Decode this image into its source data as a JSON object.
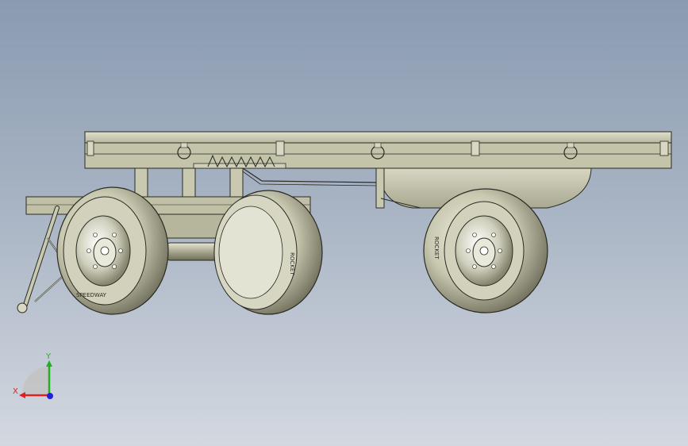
{
  "viewport": {
    "background_top": "#8a9bb1",
    "background_bottom": "#d3d8e0"
  },
  "model": {
    "body_color": "#c9c9b1",
    "shade_color": "#8f8f7a",
    "line_color": "#2a2a22",
    "tire_text_front": "SPEEDWAY",
    "tire_text_rear": "ROCKET"
  },
  "triad": {
    "x_label": "X",
    "y_label": "Y",
    "x_color": "#e02020",
    "y_color": "#20b020",
    "z_color": "#2020e0"
  }
}
